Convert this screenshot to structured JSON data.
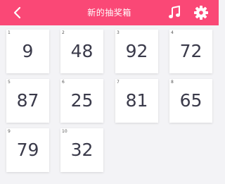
{
  "header": {
    "title": "新的抽奖箱",
    "back_icon": "back-chevron-icon",
    "music_icon": "music-note-icon",
    "settings_icon": "gear-icon",
    "bar_color": "#fa4876"
  },
  "cards": [
    {
      "index": "1",
      "value": "9"
    },
    {
      "index": "2",
      "value": "48"
    },
    {
      "index": "3",
      "value": "92"
    },
    {
      "index": "4",
      "value": "72"
    },
    {
      "index": "5",
      "value": "87"
    },
    {
      "index": "6",
      "value": "25"
    },
    {
      "index": "7",
      "value": "81"
    },
    {
      "index": "8",
      "value": "65"
    },
    {
      "index": "9",
      "value": "79"
    },
    {
      "index": "10",
      "value": "32"
    }
  ]
}
